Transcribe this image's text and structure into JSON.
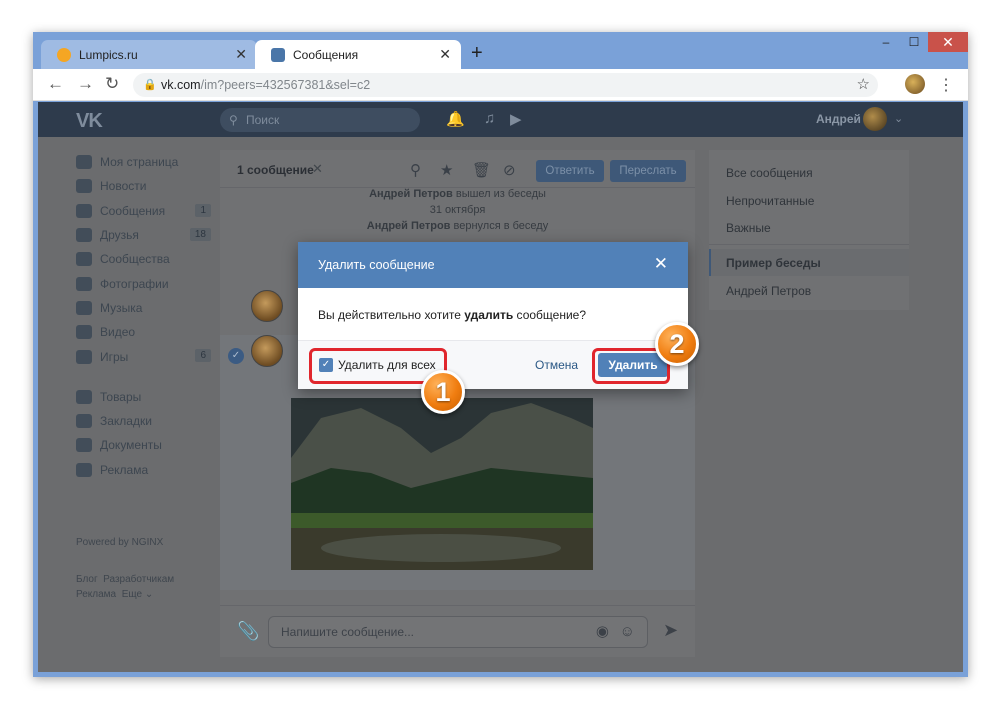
{
  "browser": {
    "tabs": [
      {
        "title": "Lumpics.ru",
        "active": false
      },
      {
        "title": "Сообщения",
        "active": true
      }
    ],
    "new_tab": "+",
    "url_host": "vk.com",
    "url_path": "/im?peers=432567381&sel=c2",
    "window_buttons": [
      "–",
      "☐",
      "✕"
    ]
  },
  "vk": {
    "logo": "VK",
    "search_placeholder": "Поиск",
    "user_name": "Андрей",
    "menu": [
      {
        "label": "Моя страница",
        "counter": ""
      },
      {
        "label": "Новости",
        "counter": ""
      },
      {
        "label": "Сообщения",
        "counter": "1"
      },
      {
        "label": "Друзья",
        "counter": "18"
      },
      {
        "label": "Сообщества",
        "counter": ""
      },
      {
        "label": "Фотографии",
        "counter": ""
      },
      {
        "label": "Музыка",
        "counter": ""
      },
      {
        "label": "Видео",
        "counter": ""
      },
      {
        "label": "Игры",
        "counter": "6"
      }
    ],
    "menu2": [
      {
        "label": "Товары"
      },
      {
        "label": "Закладки"
      },
      {
        "label": "Документы"
      },
      {
        "label": "Реклама"
      }
    ],
    "powered": "Powered by NGINX",
    "footer": [
      "Блог",
      "Разработчикам",
      "Реклама",
      "Еще ⌄"
    ]
  },
  "chat": {
    "selected_count": "1 сообщение",
    "reply_button": "Ответить",
    "forward_button": "Пересл­ать",
    "sys_left_name": "Андрей Петров",
    "sys_left_text": "вышел из беседы",
    "sys_date": "31 октября",
    "sys_return_name": "Андрей Петров",
    "sys_return_text": "вернулся в беседу",
    "compose_placeholder": "Напишите сообщение..."
  },
  "right_panel": {
    "items": [
      "Все сообщения",
      "Непрочитанные",
      "Важные",
      "Пример беседы",
      "Андрей Петров"
    ]
  },
  "modal": {
    "title": "Удалить сообщение",
    "text_before": "Вы действительно хотите ",
    "text_bold": "удалить",
    "text_after": " сообщение?",
    "checkbox_label": "Удалить для всех",
    "checkbox_checked": true,
    "cancel_label": "Отмена",
    "delete_label": "Удалить"
  },
  "callouts": {
    "step1": "1",
    "step2": "2",
    "highlight_color": "#e0262d",
    "badge_color": "#f07d10"
  }
}
